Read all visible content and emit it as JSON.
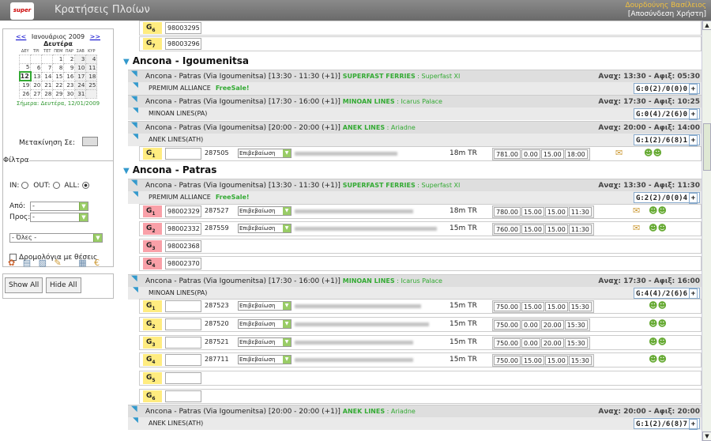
{
  "app": {
    "title": "Κρατήσεις Πλοίων",
    "user": "Δουρδούνης Βασίλειος",
    "logout": "[Αποσύνδεση Χρήστη]",
    "logo": "super cargo"
  },
  "calendar": {
    "prev": "<<",
    "next": ">>",
    "month": "Ιανουάριος 2009",
    "weekday": "Δευτέρα",
    "dow": [
      "ΔΕΥ",
      "ΤΡΙ",
      "ΤΕΤ",
      "ΠΕΜ",
      "ΠΑΡ",
      "ΣΑΒ",
      "ΚΥΡ"
    ],
    "weeks": [
      [
        "",
        "",
        "",
        "1",
        "2",
        "3",
        "4"
      ],
      [
        "5",
        "6",
        "7",
        "8",
        "9",
        "10",
        "11"
      ],
      [
        "12",
        "13",
        "14",
        "15",
        "16",
        "17",
        "18"
      ],
      [
        "19",
        "20",
        "21",
        "22",
        "23",
        "24",
        "25"
      ],
      [
        "26",
        "27",
        "28",
        "29",
        "30",
        "31",
        ""
      ]
    ],
    "today_label": "Σήμερα: Δευτέρα, 12/01/2009",
    "move_label": "Μετακίνηση Σε:"
  },
  "filter": {
    "legend": "Φίλτρα",
    "in": "IN:",
    "out": "OUT:",
    "all": "ALL:",
    "from_label": "Από:",
    "from_value": "-",
    "to_label": "Προς:",
    "to_value": "-",
    "all_value": "- Όλες -",
    "checkbox_label": "Δρομολόγια με θέσεις"
  },
  "buttons": {
    "show_all": "Show All",
    "hide_all": "Hide All"
  },
  "status_label": "Επιβεβαίωση",
  "rows": {
    "g6a": {
      "code": "G",
      "sub": "6",
      "num": "98003295"
    },
    "g7a": {
      "code": "G",
      "sub": "7",
      "num": "98003296"
    },
    "route1": "Ancona - Igoumenitsa",
    "t1": {
      "lbl": "Ancona - Patras (Via Igoumenitsa) [13:30 - 11:30 (+1)]",
      "co": "SUPERFAST FERRIES",
      "ship": "Superfast XI",
      "times": "Αναχ: 13:30 - Αφιξ: 05:30"
    },
    "a1": {
      "lbl": "PREMIUM ALLIANCE",
      "fs": "FreeSale!",
      "cnt": "G:0(2)/0(0)0"
    },
    "t2": {
      "lbl": "Ancona - Patras (Via Igoumenitsa) [17:30 - 16:00 (+1)]",
      "co": "MINOAN LINES",
      "ship": "Icarus Palace",
      "times": "Αναχ: 17:30 - Αφιξ: 10:25"
    },
    "a2": {
      "lbl": "MINOAN LINES(PA)",
      "cnt": "G:0(4)/2(6)0"
    },
    "t3": {
      "lbl": "Ancona - Patras (Via Igoumenitsa) [20:00 - 20:00 (+1)]",
      "co": "ANEK LINES",
      "ship": "Ariadne",
      "times": "Αναχ: 20:00 - Αφιξ: 14:00"
    },
    "a3": {
      "lbl": "ANEK LINES(ATH)",
      "cnt": "G:1(2)/6(8)1"
    },
    "s1": {
      "code": "G",
      "sub": "1",
      "num": "",
      "tk": "287505",
      "len": "18m TR",
      "p": [
        "781.00",
        "0.00",
        "15.00",
        "18:00"
      ]
    },
    "route2": "Ancona - Patras",
    "t4": {
      "lbl": "Ancona - Patras (Via Igoumenitsa) [13:30 - 11:30 (+1)]",
      "co": "SUPERFAST FERRIES",
      "ship": "Superfast XI",
      "times": "Αναχ: 13:30 - Αφιξ: 11:30"
    },
    "a4": {
      "lbl": "PREMIUM ALLIANCE",
      "fs": "FreeSale!",
      "cnt": "G:2(2)/0(0)4"
    },
    "s2": {
      "code": "G",
      "sub": "1",
      "num": "98002329",
      "tk": "287527",
      "len": "18m TR",
      "p": [
        "780.00",
        "15.00",
        "15.00",
        "11:30"
      ]
    },
    "s3": {
      "code": "G",
      "sub": "2",
      "num": "98002332",
      "tk": "287559",
      "len": "15m TR",
      "p": [
        "760.00",
        "15.00",
        "15.00",
        "11:30"
      ]
    },
    "s4": {
      "code": "G",
      "sub": "3",
      "num": "98002368"
    },
    "s5": {
      "code": "G",
      "sub": "4",
      "num": "98002370"
    },
    "t5": {
      "lbl": "Ancona - Patras (Via Igoumenitsa) [17:30 - 16:00 (+1)]",
      "co": "MINOAN LINES",
      "ship": "Icarus Palace",
      "times": "Αναχ: 17:30 - Αφιξ: 16:00"
    },
    "a5": {
      "lbl": "MINOAN LINES(PA)",
      "cnt": "G:4(4)/2(6)6"
    },
    "s6": {
      "code": "G",
      "sub": "1",
      "num": "",
      "tk": "287523",
      "len": "15m TR",
      "p": [
        "750.00",
        "15.00",
        "15.00",
        "15:30"
      ]
    },
    "s7": {
      "code": "G",
      "sub": "2",
      "num": "",
      "tk": "287520",
      "len": "15m TR",
      "p": [
        "750.00",
        "0.00",
        "20.00",
        "15:30"
      ]
    },
    "s8": {
      "code": "G",
      "sub": "3",
      "num": "",
      "tk": "287521",
      "len": "15m TR",
      "p": [
        "750.00",
        "0.00",
        "20.00",
        "15:30"
      ]
    },
    "s9": {
      "code": "G",
      "sub": "4",
      "num": "",
      "tk": "287711",
      "len": "15m TR",
      "p": [
        "750.00",
        "15.00",
        "15.00",
        "15:30"
      ]
    },
    "s10": {
      "code": "G",
      "sub": "5",
      "num": ""
    },
    "s11": {
      "code": "G",
      "sub": "6",
      "num": ""
    },
    "t6": {
      "lbl": "Ancona - Patras (Via Igoumenitsa) [20:00 - 20:00 (+1)]",
      "co": "ANEK LINES",
      "ship": "Ariadne",
      "times": "Αναχ: 20:00 - Αφιξ: 20:00"
    },
    "a6": {
      "lbl": "ANEK LINES(ATH)",
      "cnt": "G:1(2)/6(8)7"
    }
  }
}
